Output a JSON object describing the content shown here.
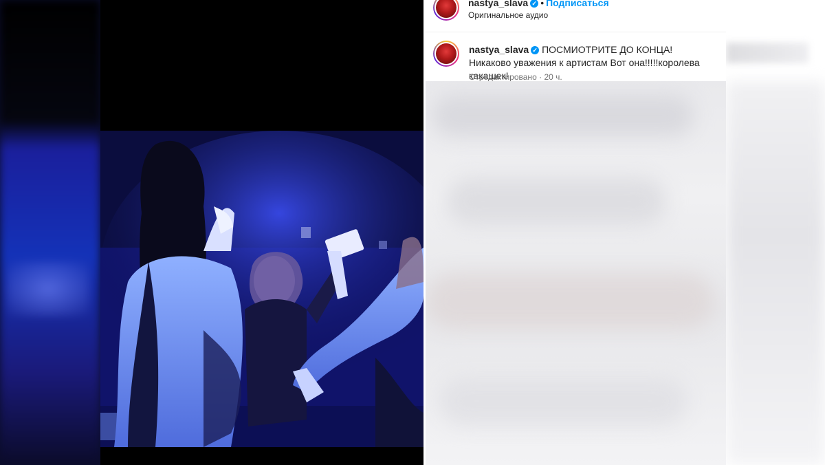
{
  "post": {
    "username": "nastya_slava",
    "separator": "•",
    "follow_label": "Подписаться",
    "audio_label": "Оригинальное аудио",
    "verified_glyph": "✓"
  },
  "caption": {
    "username": "nastya_slava",
    "text": "ПОСМИОТРИТЕ ДО КОНЦА! Никаково уважения к артистам Вот она!!!!!королева какашек!",
    "edited_label": "Отредактировано",
    "meta_separator": "·",
    "time_ago": "20 ч."
  },
  "icons": {
    "verified": "verified-badge-icon",
    "avatar": "profile-avatar"
  },
  "colors": {
    "link_blue": "#0095f6",
    "text_primary": "#262626",
    "text_secondary": "#737373",
    "stage_blue": "#1b2aa8"
  }
}
